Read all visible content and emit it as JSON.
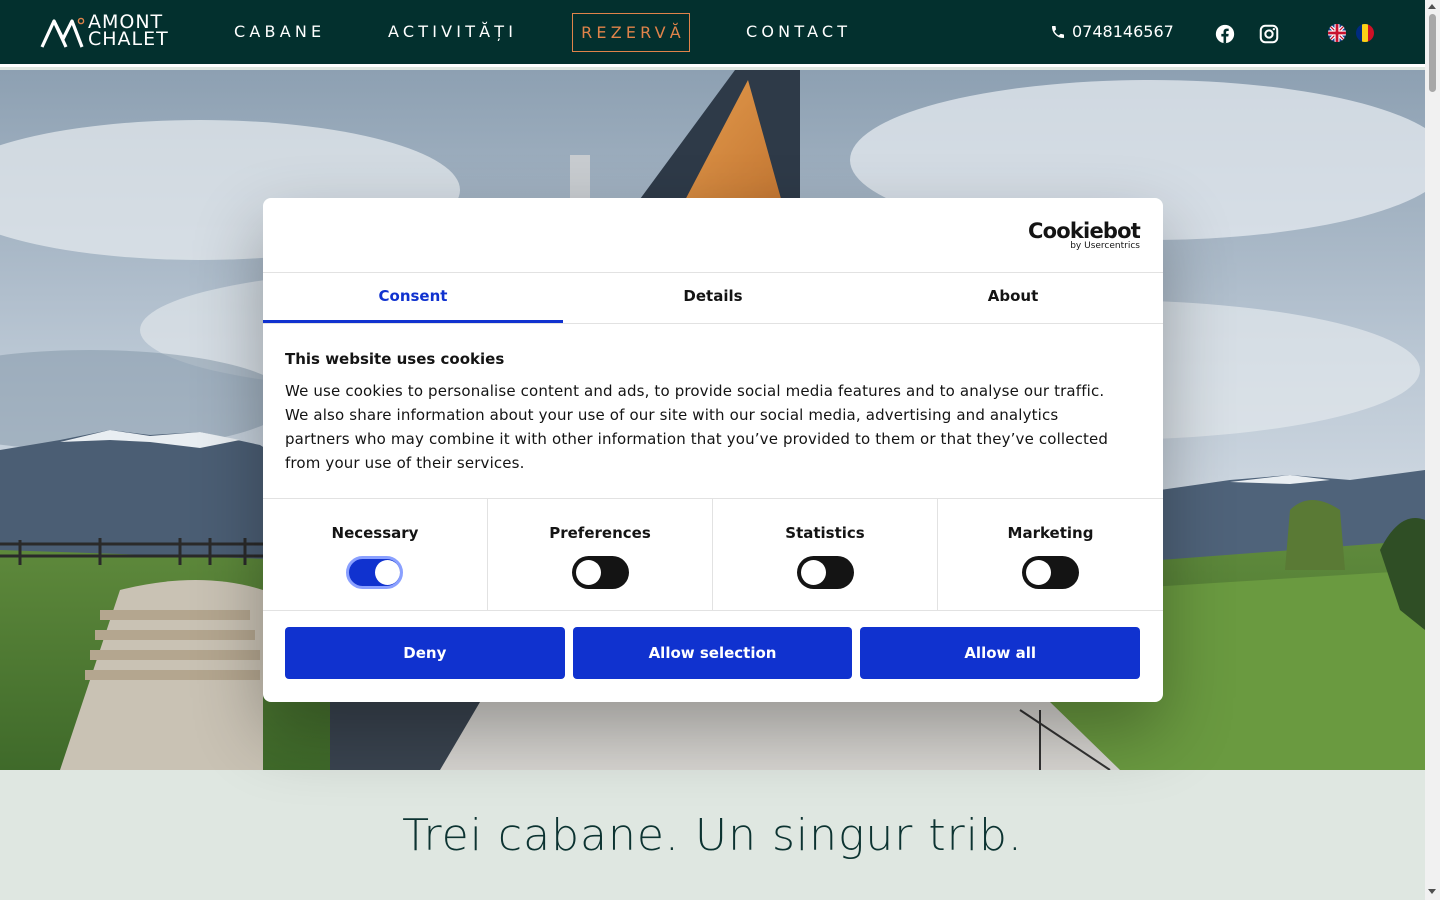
{
  "nav": {
    "logo_line1": "AMONT",
    "logo_line2": "CHALET",
    "links": [
      "CABANE",
      "ACTIVITĂȚI",
      "CONTACT"
    ],
    "book_label": "REZERVĂ",
    "phone": "0748146567",
    "social": [
      "facebook-icon",
      "instagram-icon"
    ],
    "languages": [
      "en-flag-icon",
      "ro-flag-icon"
    ]
  },
  "hero": {
    "image": "a-frame-chalet-mountain-landscape"
  },
  "lower": {
    "tagline": "Trei cabane. Un singur trib."
  },
  "cookie_dialog": {
    "brand_name": "Cookiebot",
    "brand_by": "by Usercentrics",
    "tabs": [
      {
        "label": "Consent",
        "active": true
      },
      {
        "label": "Details",
        "active": false
      },
      {
        "label": "About",
        "active": false
      }
    ],
    "title": "This website uses cookies",
    "text": "We use cookies to personalise content and ads, to provide social media features and to analyse our traffic. We also share information about your use of our site with our social media, advertising and analytics partners who may combine it with other information that you’ve provided to them or that they’ve collected from your use of their services.",
    "categories": [
      {
        "label": "Necessary",
        "enabled": true
      },
      {
        "label": "Preferences",
        "enabled": false
      },
      {
        "label": "Statistics",
        "enabled": false
      },
      {
        "label": "Marketing",
        "enabled": false
      }
    ],
    "buttons": {
      "deny": "Deny",
      "allow_selection": "Allow selection",
      "allow_all": "Allow all"
    },
    "accent_color": "#1032cf"
  },
  "colors": {
    "nav_bg": "#03302e",
    "book_accent": "#e0834a",
    "lower_bg": "#dfe7e1"
  }
}
